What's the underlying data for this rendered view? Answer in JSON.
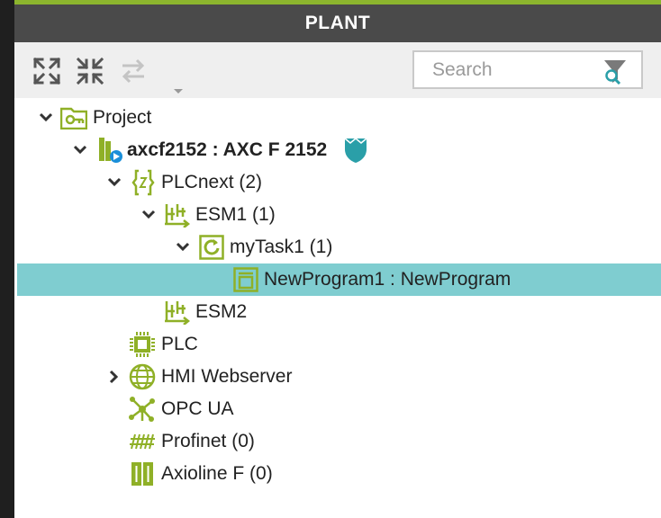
{
  "header": {
    "title": "PLANT"
  },
  "toolbar": {
    "expand_icon": "expand-all-icon",
    "collapse_icon": "collapse-all-icon",
    "sync_icon": "sync-arrows-icon"
  },
  "search": {
    "placeholder": "Search",
    "icon": "search-filter-icon"
  },
  "tree": {
    "project": {
      "label": "Project",
      "icon": "project-icon"
    },
    "device": {
      "label": "axcf2152 : AXC F 2152",
      "icon": "controller-icon",
      "badge": "security-shield-icon"
    },
    "plcnext": {
      "label": "PLCnext (2)",
      "icon": "braces-icon"
    },
    "esm1": {
      "label": "ESM1 (1)",
      "icon": "esm-icon"
    },
    "mytask1": {
      "label": "myTask1 (1)",
      "icon": "cyclic-task-icon"
    },
    "newprogram1": {
      "label": "NewProgram1 : NewProgram",
      "icon": "program-icon"
    },
    "esm2": {
      "label": "ESM2",
      "icon": "esm-icon"
    },
    "plc": {
      "label": "PLC",
      "icon": "chip-icon"
    },
    "hmi": {
      "label": "HMI Webserver",
      "icon": "globe-icon"
    },
    "opcua": {
      "label": "OPC UA",
      "icon": "network-hub-icon"
    },
    "profinet": {
      "label": "Profinet (0)",
      "icon": "profinet-icon"
    },
    "axioline": {
      "label": "Axioline F (0)",
      "icon": "axioline-icon"
    }
  },
  "colors": {
    "accent": "#8cb52e",
    "icon_green": "#8fb027",
    "selection": "#7fcdd0",
    "shield": "#2a9fa8"
  }
}
